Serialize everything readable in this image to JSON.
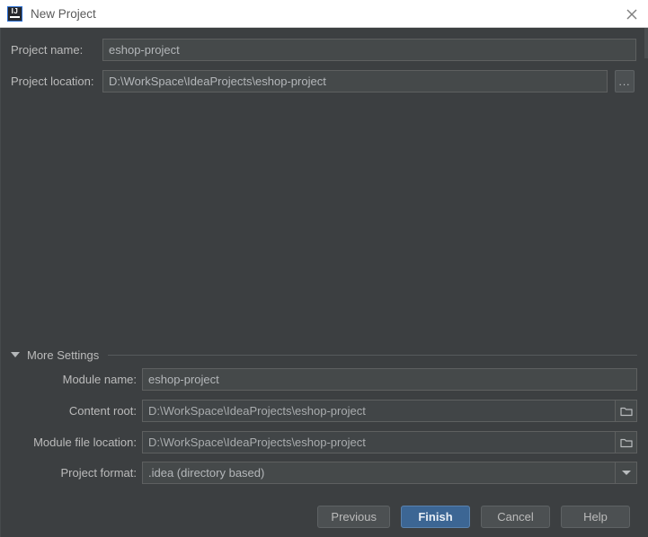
{
  "window": {
    "title": "New Project",
    "logo_icon": "intellij-idea-logo",
    "close_icon": "close-icon"
  },
  "main": {
    "project_name": {
      "label": "Project name:",
      "value": "eshop-project"
    },
    "project_location": {
      "label": "Project location:",
      "value": "D:\\WorkSpace\\IdeaProjects\\eshop-project",
      "browse_label": "...",
      "browse_icon": "ellipsis-icon"
    }
  },
  "more_settings": {
    "label": "More Settings",
    "expander_icon": "triangle-down-icon",
    "expanded": true,
    "fields": {
      "module_name": {
        "label": "Module name:",
        "value": "eshop-project"
      },
      "content_root": {
        "label": "Content root:",
        "value": "D:\\WorkSpace\\IdeaProjects\\eshop-project",
        "browse_icon": "folder-icon"
      },
      "module_file_location": {
        "label": "Module file location:",
        "value": "D:\\WorkSpace\\IdeaProjects\\eshop-project",
        "browse_icon": "folder-icon"
      },
      "project_format": {
        "label": "Project format:",
        "value": ".idea (directory based)",
        "dropdown_icon": "chevron-down-icon"
      }
    }
  },
  "footer": {
    "previous_label": "Previous",
    "finish_label": "Finish",
    "cancel_label": "Cancel",
    "help_label": "Help"
  },
  "colors": {
    "dialog_bg": "#3c3f41",
    "titlebar_bg": "#ffffff",
    "field_bg": "#45494a",
    "field_border": "#5e6060",
    "text": "#bbbbbb",
    "primary_button_bg": "#3c6694",
    "logo_accent": "#2b6fd4"
  }
}
